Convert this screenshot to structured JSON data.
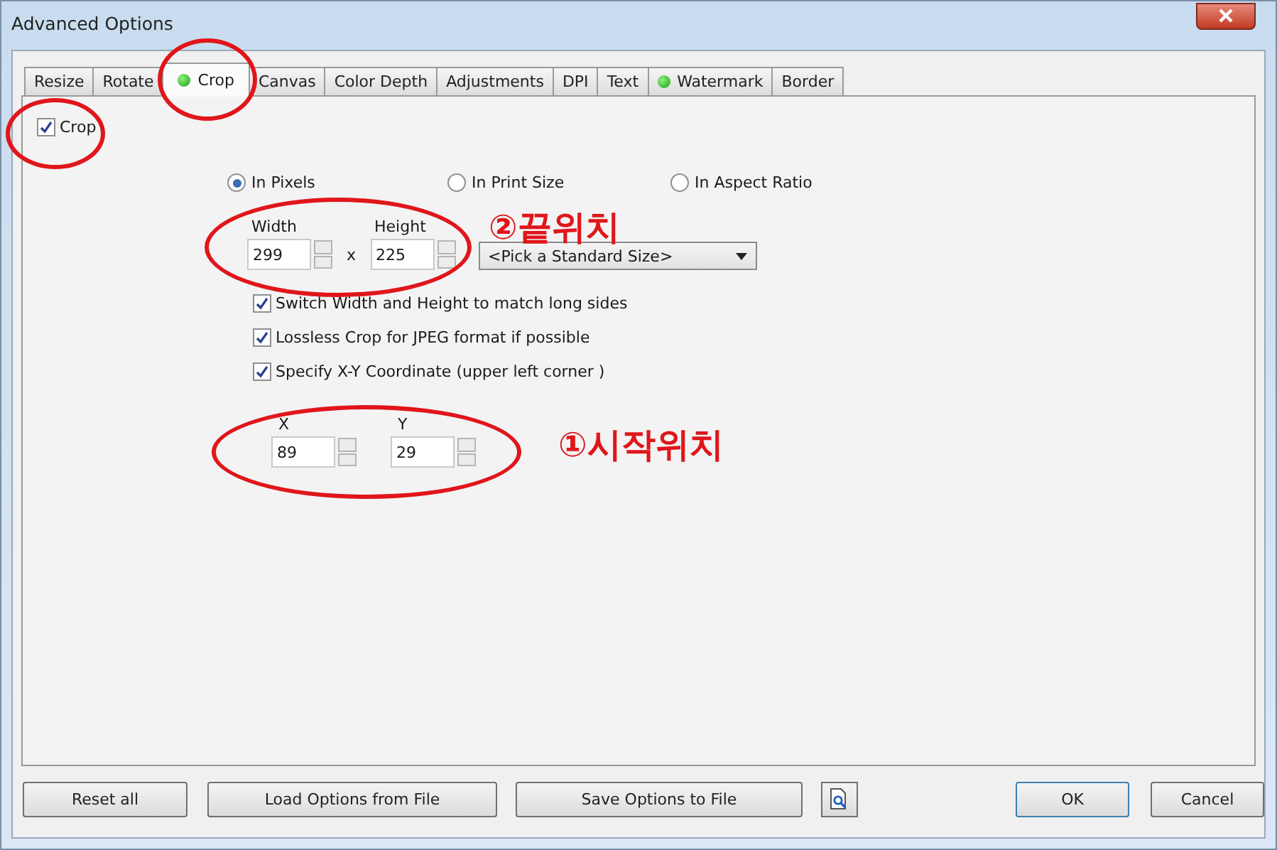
{
  "window": {
    "title": "Advanced Options"
  },
  "tabs": [
    {
      "label": "Resize",
      "selected": false,
      "indicator": false
    },
    {
      "label": "Rotate",
      "selected": false,
      "indicator": false
    },
    {
      "label": "Crop",
      "selected": true,
      "indicator": true
    },
    {
      "label": "Canvas",
      "selected": false,
      "indicator": false
    },
    {
      "label": "Color Depth",
      "selected": false,
      "indicator": false
    },
    {
      "label": "Adjustments",
      "selected": false,
      "indicator": false
    },
    {
      "label": "DPI",
      "selected": false,
      "indicator": false
    },
    {
      "label": "Text",
      "selected": false,
      "indicator": false
    },
    {
      "label": "Watermark",
      "selected": false,
      "indicator": true
    },
    {
      "label": "Border",
      "selected": false,
      "indicator": false
    }
  ],
  "crop_checkbox": {
    "label": "Crop",
    "checked": true
  },
  "size_modes": [
    {
      "label": "In Pixels",
      "selected": true
    },
    {
      "label": "In Print Size",
      "selected": false
    },
    {
      "label": "In Aspect Ratio",
      "selected": false
    }
  ],
  "size": {
    "width_label": "Width",
    "width_value": "299",
    "times_sign": "x",
    "height_label": "Height",
    "height_value": "225",
    "standard_size": "<Pick a Standard Size>"
  },
  "options": [
    {
      "label": "Switch Width and Height to match long sides",
      "checked": true
    },
    {
      "label": "Lossless Crop for JPEG format if possible",
      "checked": true
    },
    {
      "label": "Specify X-Y Coordinate (upper left corner )",
      "checked": true
    }
  ],
  "coordinate": {
    "x_label": "X",
    "x_value": "89",
    "y_label": "Y",
    "y_value": "29"
  },
  "annotations": [
    {
      "text": "②끝위치"
    },
    {
      "text": "①시작위치"
    }
  ],
  "buttons": [
    {
      "label": "Reset all"
    },
    {
      "label": "Load Options from File"
    },
    {
      "label": "Save Options to File"
    }
  ],
  "dialog_buttons": [
    {
      "label": "OK"
    },
    {
      "label": "Cancel"
    }
  ]
}
